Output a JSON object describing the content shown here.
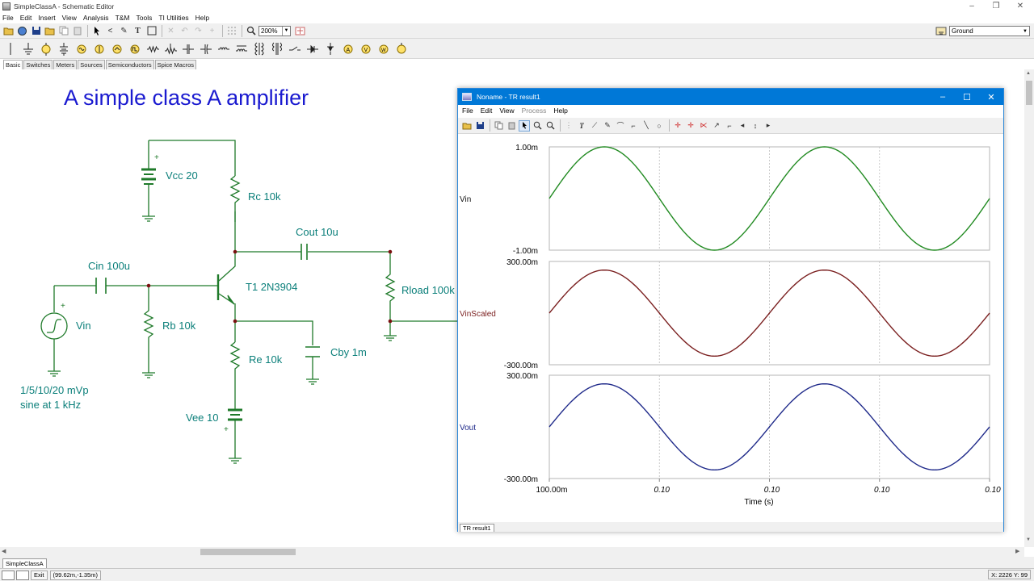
{
  "window": {
    "title": "SimpleClassA - Schematic Editor",
    "controls": [
      "–",
      "❐",
      "✕"
    ]
  },
  "menu": [
    "File",
    "Edit",
    "Insert",
    "View",
    "Analysis",
    "T&M",
    "Tools",
    "TI Utilities",
    "Help"
  ],
  "toolbar": {
    "zoom": "200%",
    "component_select": "Ground"
  },
  "component_tabs": [
    "Basic",
    "Switches",
    "Meters",
    "Sources",
    "Semiconductors",
    "Spice Macros"
  ],
  "schematic": {
    "title": "A simple class A amplifier",
    "labels": {
      "vcc": "Vcc 20",
      "rc": "Rc 10k",
      "cout": "Cout 10u",
      "cin": "Cin 100u",
      "t1": "T1 2N3904",
      "rload": "Rload 100k",
      "vin": "Vin",
      "rb": "Rb 10k",
      "re": "Re 10k",
      "cby": "Cby 1m",
      "vee": "Vee 10",
      "src_desc_1": "1/5/10/20 mVp",
      "src_desc_2": "sine at 1 kHz",
      "plus": "+"
    }
  },
  "document_tab": "SimpleClassA",
  "statusbar": {
    "exit": "Exit",
    "coords": "(99.62m,-1.35m)",
    "position": "X: 2226  Y: 99"
  },
  "tr_window": {
    "title": "Noname - TR result1",
    "menu": [
      "File",
      "Edit",
      "View",
      "Process",
      "Help"
    ],
    "tab": "TR result1",
    "controls": [
      "–",
      "☐",
      "✕"
    ]
  },
  "chart_data": {
    "type": "line",
    "xlabel": "Time (s)",
    "x_tick_labels": [
      "100.00m",
      "0.10",
      "0.10",
      "0.10",
      "0.10"
    ],
    "x_range_s": [
      0.1,
      0.102
    ],
    "grid": "dashed vertical",
    "panels": [
      {
        "name": "Vin",
        "color": "#228b22",
        "ymax_label": "1.00m",
        "ymin_label": "-1.00m",
        "ylim": [
          -0.001,
          0.001
        ],
        "amplitude": 0.001,
        "frequency_hz": 1000,
        "phase": "sine"
      },
      {
        "name": "VinScaled",
        "color": "#7a1f1f",
        "ymax_label": "300.00m",
        "ymin_label": "-300.00m",
        "ylim": [
          -0.3,
          0.3
        ],
        "amplitude": 0.25,
        "frequency_hz": 1000,
        "phase": "sine"
      },
      {
        "name": "Vout",
        "color": "#1f2a8a",
        "ymax_label": "300.00m",
        "ymin_label": "-300.00m",
        "ylim": [
          -0.3,
          0.3
        ],
        "amplitude": 0.25,
        "frequency_hz": 1000,
        "phase": "sine"
      }
    ]
  }
}
